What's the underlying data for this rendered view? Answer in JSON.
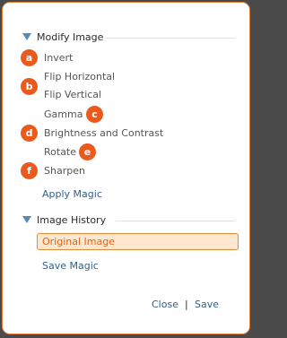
{
  "modify": {
    "title": "Modify Image",
    "items": [
      {
        "label": "Invert",
        "badge": "a"
      },
      {
        "label": "Flip Horizontal",
        "badge": "b"
      },
      {
        "label": "Flip Vertical",
        "badge": ""
      },
      {
        "label": "Gamma",
        "badge": "c"
      },
      {
        "label": "Brightness and Contrast",
        "badge": "d"
      },
      {
        "label": "Rotate",
        "badge": "e"
      },
      {
        "label": "Sharpen",
        "badge": "f"
      }
    ],
    "apply_label": "Apply Magic"
  },
  "history": {
    "title": "Image History",
    "original_label": "Original Image",
    "save_magic_label": "Save Magic"
  },
  "footer": {
    "close_label": "Close",
    "separator": "|",
    "save_label": "Save"
  },
  "colors": {
    "badge": "#ea5a1d",
    "link": "#2f5f8c",
    "accent_border": "#e08a3a",
    "selected_bg": "#fde8cf"
  }
}
